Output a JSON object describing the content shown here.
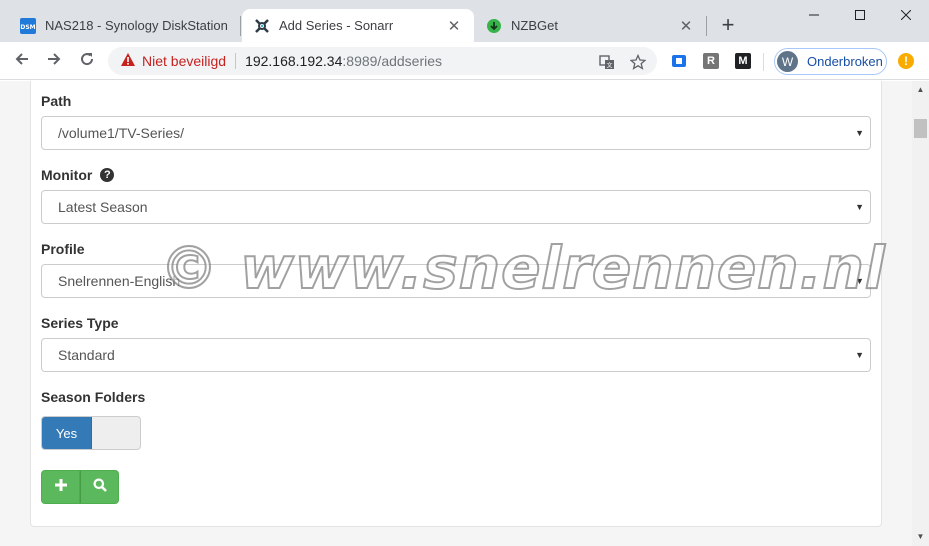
{
  "tabs": [
    {
      "title": "NAS218 - Synology DiskStation",
      "favicon": "dsm-icon",
      "favicon_text": "DSM",
      "active": false
    },
    {
      "title": "Add Series - Sonarr",
      "favicon": "sonarr-icon",
      "active": true
    },
    {
      "title": "NZBGet",
      "favicon": "nzbget-icon",
      "active": false
    }
  ],
  "omnibox": {
    "security_label": "Niet beveiligd",
    "host": "192.168.192.34",
    "path": ":8989/addseries"
  },
  "extensions": {
    "r_label": "R",
    "m_label": "M"
  },
  "profile": {
    "initial": "W",
    "label": "Onderbroken"
  },
  "update_badge": "!",
  "form": {
    "path_label": "Path",
    "path_value": "/volume1/TV-Series/",
    "monitor_label": "Monitor",
    "monitor_help": "?",
    "monitor_value": "Latest Season",
    "profile_label": "Profile",
    "profile_value": "Snelrennen-English",
    "series_type_label": "Series Type",
    "series_type_value": "Standard",
    "season_folders_label": "Season Folders",
    "season_folders_toggle": "Yes"
  },
  "watermark": "© www.snelrennen.nl",
  "colors": {
    "primary": "#337ab7",
    "success": "#5cb85c",
    "warning": "#c5221f"
  }
}
